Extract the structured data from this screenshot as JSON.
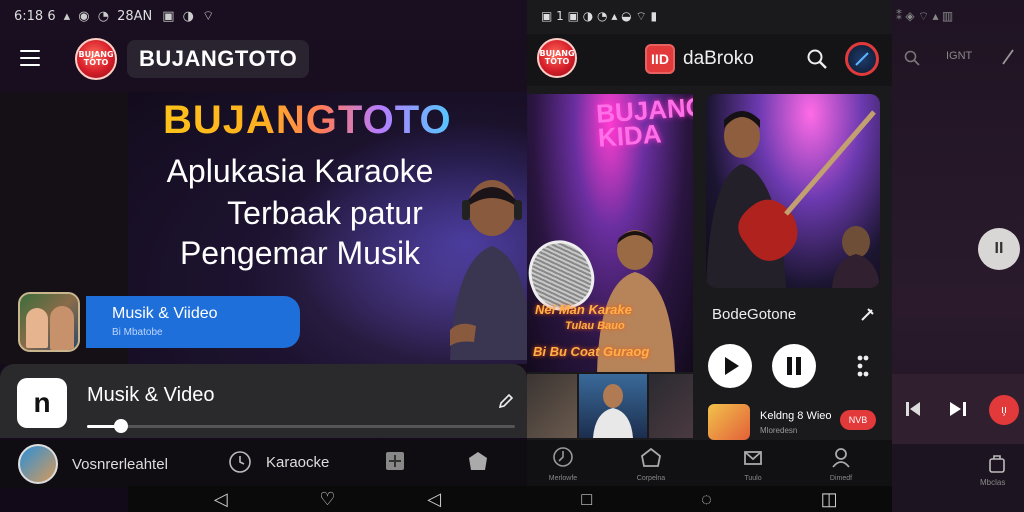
{
  "left": {
    "status": {
      "time": "6:18 6",
      "extra": "28AN"
    },
    "brand": "BUJANGTOTO",
    "logo_text": "BUJANG TOTO",
    "hero": {
      "title": "BUJANGTOTO",
      "line1": "Aplukasia Karaoke",
      "line2": "Terbaak patur",
      "line3": "Pengemar Musik"
    },
    "chip": {
      "title": "Musik & Viideo",
      "sub": "Bi Mbatobe"
    },
    "player": {
      "icon_letter": "n",
      "title": "Musik & Video",
      "progress": 0.08
    },
    "nav": {
      "profile_label": "Vosnrerleahtel",
      "karaoke_label": "Karaocke"
    }
  },
  "mid": {
    "logo_text": "BUJANG TOTO",
    "app_badge": "IID",
    "app_name": "daBroko",
    "poster_a": {
      "title": "BUJANG KIDA",
      "scrawl1": "Nei Man Karake",
      "scrawl2": "Tulau Bauo",
      "scrawl3": "Bi Bu Coat Guraog"
    },
    "song_title": "BodeGotone",
    "mini": {
      "title": "Keldng 8 Wieo",
      "sub": "Mloredesn",
      "pill": "NVB"
    },
    "nav_labels": [
      "Merlowfe",
      "Corpelna",
      "Tuulo",
      "Dimedf"
    ]
  },
  "right": {
    "app_badge": "IGNT",
    "fab_glyph": "II",
    "bottom_label": "Mbclas"
  },
  "colors": {
    "accent_red": "#e23a3a",
    "accent_blue": "#1e6fd9"
  }
}
